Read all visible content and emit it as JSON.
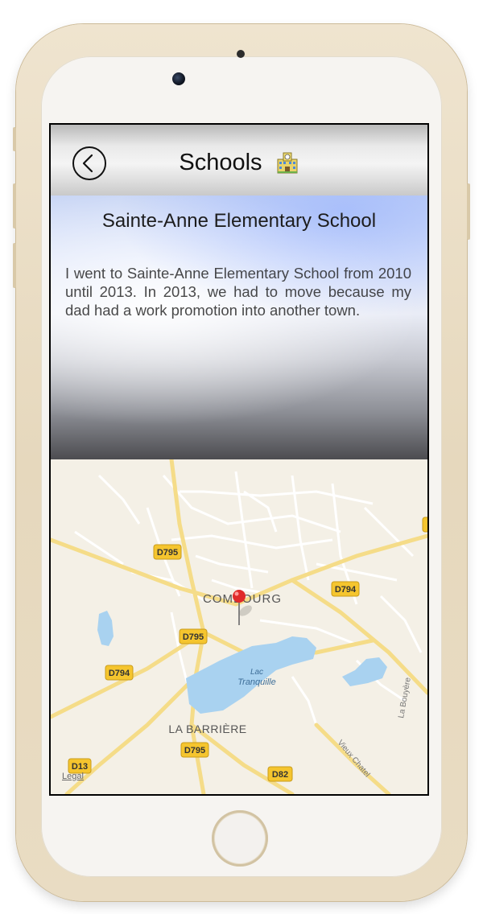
{
  "navbar": {
    "title": "Schools",
    "back_icon": "chevron-left-icon",
    "title_icon": "school-icon"
  },
  "school": {
    "name": "Sainte-Anne Elementary School",
    "description": "I went to Sainte-Anne Elementary School from 2010 until 2013. In 2013, we had to move because my dad had a work promotion into another town."
  },
  "map": {
    "town_label": "COMBOURG",
    "lake_label_line1": "Lac",
    "lake_label_line2": "Tranquille",
    "place_label": "LA BARRIÈRE",
    "road_label_1": "D795",
    "road_label_2": "D794",
    "road_label_3": "D795",
    "road_label_4": "D794",
    "road_label_5": "D795",
    "road_label_6": "D13",
    "road_label_7": "D82",
    "street_label_1": "La Bouyère",
    "street_label_2": "Vieux Chatel",
    "legal": "Legal",
    "pin_icon": "map-pin-icon",
    "colors": {
      "background": "#f4f0e6",
      "water": "#a9d2f0",
      "road": "#f5dc88",
      "road_badge": "#f5c52e",
      "pin": "#e02a2a"
    }
  }
}
